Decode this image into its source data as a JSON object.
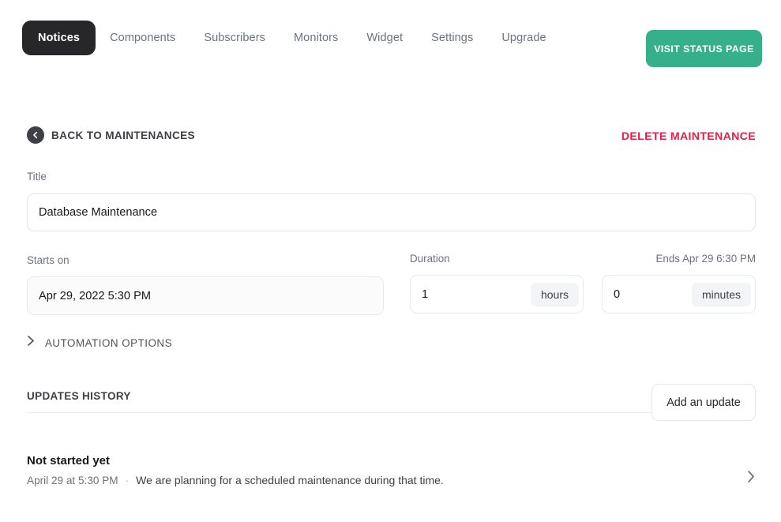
{
  "nav": {
    "items": [
      {
        "label": "Notices",
        "active": true
      },
      {
        "label": "Components",
        "active": false
      },
      {
        "label": "Subscribers",
        "active": false
      },
      {
        "label": "Monitors",
        "active": false
      },
      {
        "label": "Widget",
        "active": false
      },
      {
        "label": "Settings",
        "active": false
      },
      {
        "label": "Upgrade",
        "active": false
      }
    ],
    "visit_status_page": "VISIT STATUS PAGE"
  },
  "toolbar": {
    "back_label": "BACK TO MAINTENANCES",
    "delete_label": "DELETE MAINTENANCE"
  },
  "form": {
    "title_label": "Title",
    "title_value": "Database Maintenance",
    "title_placeholder": "Title",
    "starts_label": "Starts on",
    "starts_value": "Apr 29, 2022 5:30 PM",
    "duration_label": "Duration",
    "ends_label": "Ends Apr 29 6:30 PM",
    "hours_value": "1",
    "hours_suffix": "hours",
    "minutes_value": "0",
    "minutes_suffix": "minutes",
    "automation_label": "AUTOMATION OPTIONS"
  },
  "updates": {
    "section_title": "UPDATES HISTORY",
    "add_button": "Add an update",
    "items": [
      {
        "status": "Not started yet",
        "time": "April 29 at 5:30 PM",
        "separator": "·",
        "message": "We are planning for a scheduled maintenance during that time."
      }
    ]
  },
  "colors": {
    "accent_green": "#35b08a",
    "danger_red": "#e0214c",
    "active_tab_bg": "#27272a"
  }
}
